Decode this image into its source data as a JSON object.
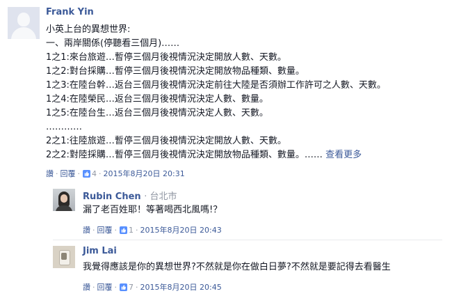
{
  "comment": {
    "author": "Frank Yin",
    "lines": [
      "小英上台的異想世界:",
      "一、兩岸關係(停聽看三個月)……",
      "1之1:來台旅遊…暫停三個月後視情況決定開放人數、天數。",
      "1之2:對台採購…暫停三個月後視情況決定開放物品種類、數量。",
      "1之3:在陸台幹…返台三個月後視情況決定前往大陸是否須辦工作許可之人數、天數。",
      "1之4:在陸榮民…返台三個月後視情況決定人數、數量。",
      "1之5:在陸台生…返台三個月後視情況決定人數、天數。",
      "…………",
      "2之1:往陸旅遊…暫停三個月後視情況決定開放人數、天數。",
      "2之2:對陸採購…暫停三個月後視情況決定開放物品種類、數量。……"
    ],
    "see_more": "查看更多",
    "like_label": "讚",
    "reply_label": "回覆",
    "like_count": "4",
    "timestamp": "2015年8月20日 20:31",
    "icon": "generic-avatar-icon"
  },
  "replies": [
    {
      "author": "Rubin Chen",
      "location": "台北市",
      "text": "漏了老百姓耶！等著喝西北風嗎!？",
      "like_label": "讚",
      "reply_label": "回覆",
      "like_count": "1",
      "timestamp": "2015年8月20日 20:43"
    },
    {
      "author": "Jim Lai",
      "text": "我覺得應該是你的異想世界?不然就是你在做白日夢?不然就是要記得去看醫生",
      "like_label": "讚",
      "reply_label": "回覆",
      "like_count": "7",
      "timestamp": "2015年8月20日 20:45"
    }
  ],
  "colors": {
    "link": "#3b5998",
    "meta": "#9197a3",
    "text": "#141823"
  }
}
